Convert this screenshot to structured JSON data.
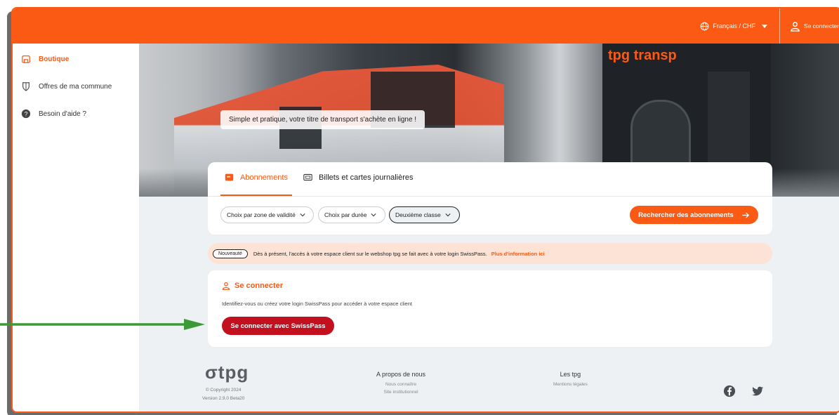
{
  "header": {
    "language_label": "Français / CHF",
    "login_label": "Se connecter"
  },
  "sidebar": {
    "items": [
      {
        "label": "Boutique",
        "icon": "shop-icon",
        "active": true
      },
      {
        "label": "Offres de ma commune",
        "icon": "shield-icon",
        "active": false
      },
      {
        "label": "Besoin d'aide ?",
        "icon": "help-icon",
        "active": false
      }
    ]
  },
  "hero": {
    "tagline": "Simple et pratique, votre titre de transport s'achète en ligne !",
    "building_sign": "tpg transp"
  },
  "tabs": [
    {
      "label": "Abonnements",
      "icon": "card-icon",
      "active": true
    },
    {
      "label": "Billets et cartes journalières",
      "icon": "ticket-icon",
      "active": false
    }
  ],
  "filters": {
    "zone_label": "Choix par zone de validité",
    "duration_label": "Choix par durée",
    "class_label": "Deuxième classe",
    "search_button": "Rechercher des abonnements"
  },
  "notice": {
    "badge": "Nouveauté",
    "text": "Dès à présent, l'accès à votre espace client sur le webshop tpg se fait avec à votre login SwissPass.",
    "link": "Plus d'information ici"
  },
  "login_card": {
    "title": "Se connecter",
    "description": "Identifiez-vous ou créez votre login SwissPass pour accéder à votre espace client",
    "button": "Se connecter avec SwissPass"
  },
  "footer": {
    "logo": "tpg",
    "copyright": "© Copyright 2024",
    "version": "Version 2.9.0 Beta20",
    "about": {
      "title": "A propos de nous",
      "links": [
        "Nous connaître",
        "Site institutionnel"
      ]
    },
    "tpg": {
      "title": "Les tpg",
      "links": [
        "Mentions légales"
      ]
    },
    "social": [
      "facebook-icon",
      "twitter-icon"
    ]
  },
  "colors": {
    "brand": "#fa5a14",
    "primary_button": "#c3101e",
    "notice_bg": "#fde3d6",
    "arrow": "#3a9a33"
  }
}
